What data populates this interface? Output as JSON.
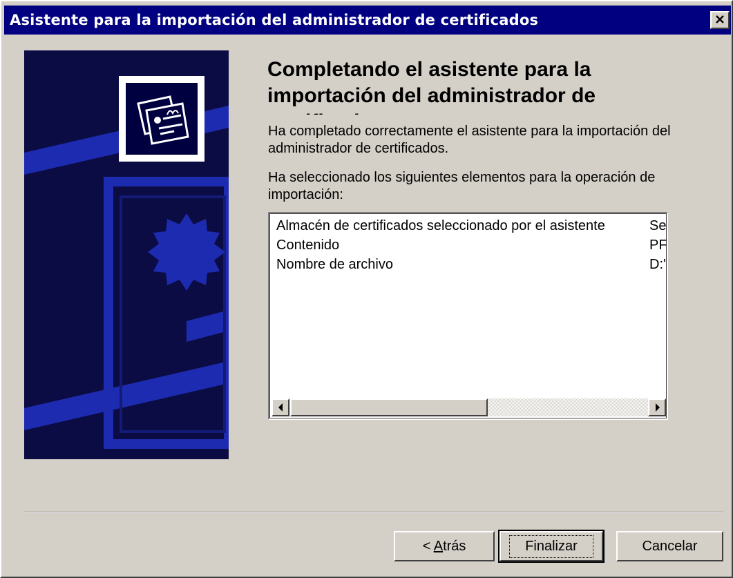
{
  "window": {
    "title": "Asistente para la importación del administrador de certificados"
  },
  "icons": {
    "close": "close-icon",
    "certificate": "certificate-icon",
    "scroll_left": "arrow-left-icon",
    "scroll_right": "arrow-right-icon"
  },
  "main": {
    "heading": "Completando el asistente para la importación del administrador de certificados",
    "intro": "Ha completado correctamente el asistente para la importación del administrador de certificados.",
    "selection_text": "Ha seleccionado los siguientes elementos para la operación de importación:"
  },
  "summary_list": {
    "rows": [
      {
        "label": "Almacén de certificados seleccionado por el asistente",
        "value": "Se"
      },
      {
        "label": "Contenido",
        "value": "PF"
      },
      {
        "label": "Nombre de archivo",
        "value": "D:'"
      }
    ]
  },
  "buttons": {
    "back_prefix": "< ",
    "back_accel": "A",
    "back_rest": "trás",
    "finish": "Finalizar",
    "cancel": "Cancelar"
  },
  "colors": {
    "titlebar": "#000080",
    "side_panel": "#0c0c44",
    "side_panel_stripes": "#1d2bb0",
    "face": "#d4d0c8"
  }
}
